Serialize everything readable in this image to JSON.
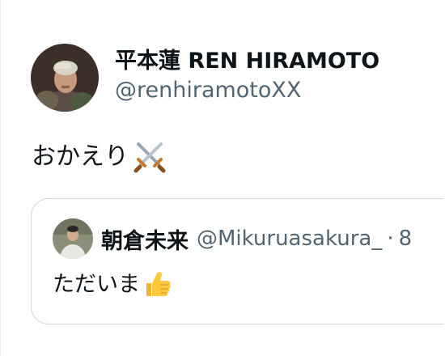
{
  "tweet": {
    "author": {
      "display_name": "平本蓮 REN HIRAMOTO",
      "handle": "@renhiramotoXX",
      "avatar_icon": "profile-photo"
    },
    "text": "おかえり",
    "emoji_icon": "crossed-swords-icon",
    "quoted": {
      "display_name": "朝倉未来",
      "handle": "@Mikuruasakura_",
      "separator": "·",
      "date": "8",
      "text": "ただいま",
      "emoji_icon": "thumbs-up-icon"
    }
  },
  "colors": {
    "text": "#0f1419",
    "secondary": "#536471",
    "border": "#cfd9de"
  }
}
